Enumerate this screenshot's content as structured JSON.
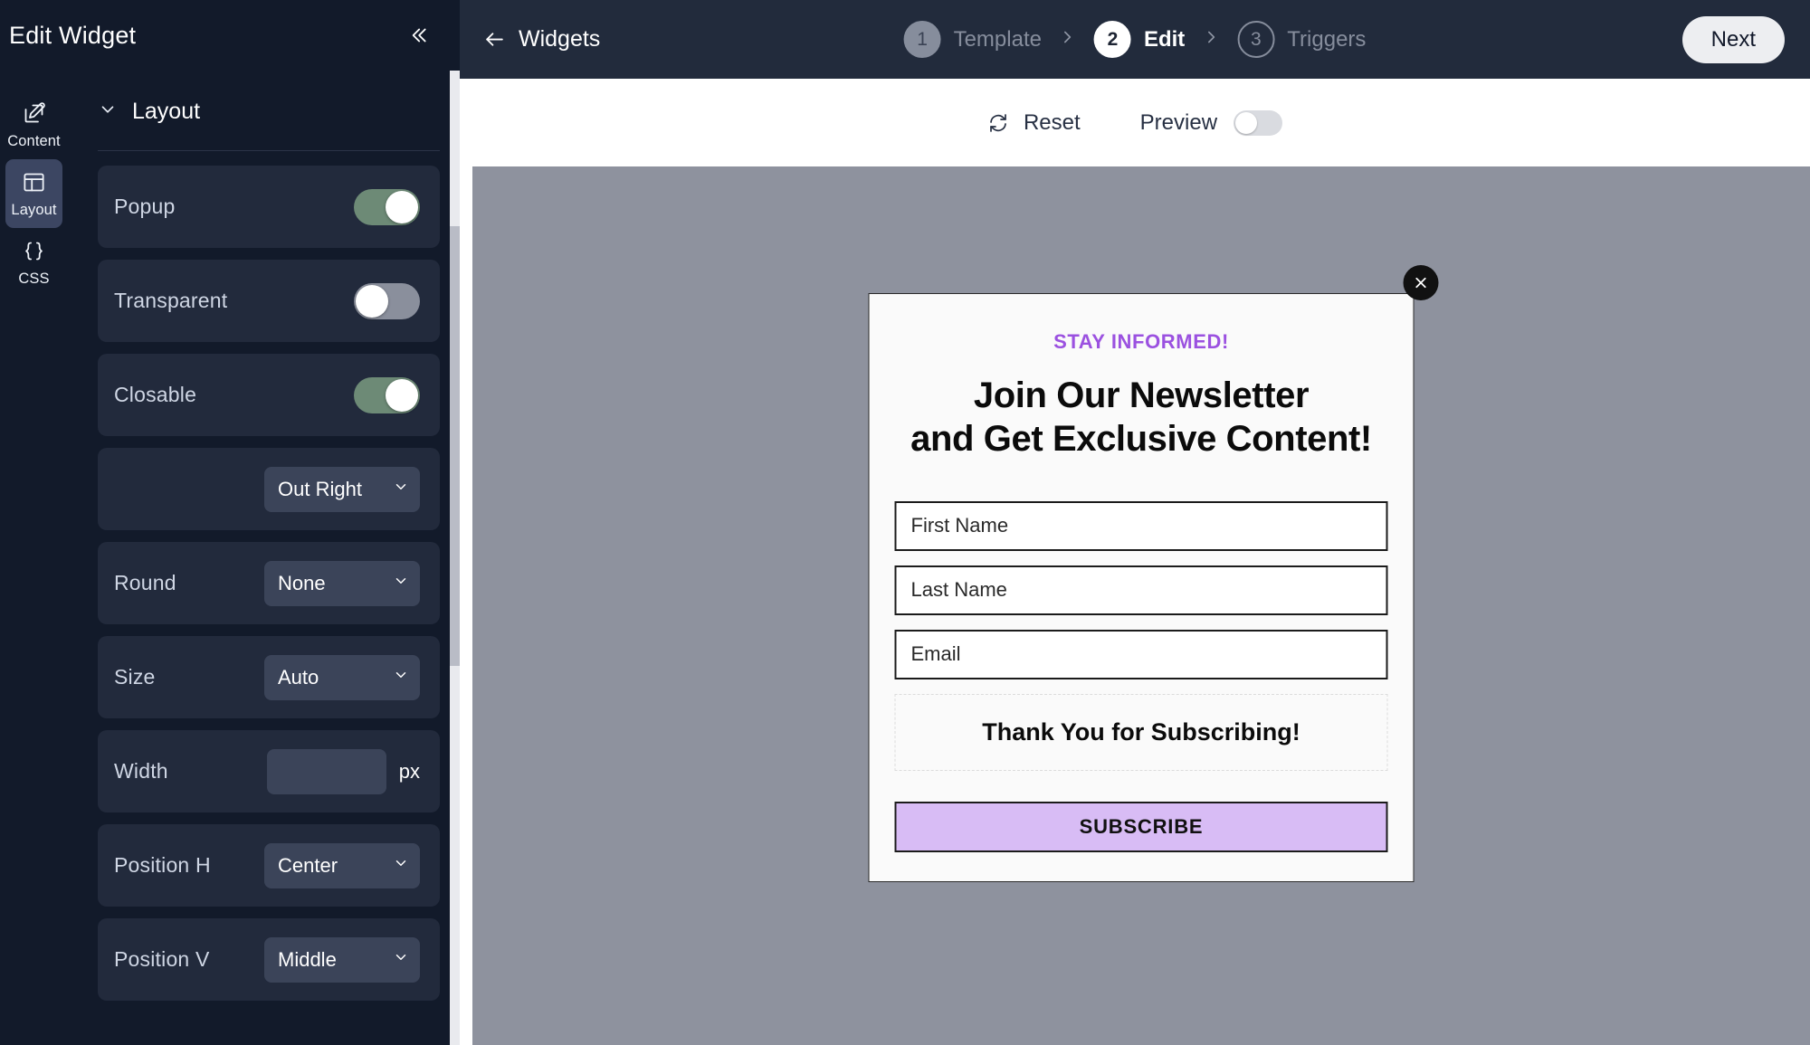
{
  "panel": {
    "title": "Edit Widget",
    "collapse_icon": "chevron-double-left-icon",
    "rail": [
      {
        "label": "Content",
        "icon": "pencil-square-icon",
        "active": false
      },
      {
        "label": "Layout",
        "icon": "layout-grid-icon",
        "active": true
      },
      {
        "label": "CSS",
        "icon": "curly-braces-icon",
        "active": false
      }
    ],
    "section": {
      "title": "Layout",
      "chevron_icon": "chevron-down-icon"
    },
    "rows": [
      {
        "label": "Popup",
        "type": "toggle",
        "value": "on"
      },
      {
        "label": "Transparent",
        "type": "toggle",
        "value": "off"
      },
      {
        "label": "Closable",
        "type": "toggle",
        "value": "on"
      },
      {
        "label": "",
        "type": "select",
        "value": "Out Right"
      },
      {
        "label": "Round",
        "type": "select",
        "value": "None"
      },
      {
        "label": "Size",
        "type": "select",
        "value": "Auto"
      },
      {
        "label": "Width",
        "type": "number",
        "value": "",
        "placeholder": "",
        "unit": "px"
      },
      {
        "label": "Position H",
        "type": "select",
        "value": "Center"
      },
      {
        "label": "Position V",
        "type": "select",
        "value": "Middle"
      }
    ]
  },
  "topbar": {
    "back_label": "Widgets",
    "back_icon": "arrow-left-icon",
    "separator_icon": "chevron-right-icon",
    "steps": [
      {
        "num": "1",
        "label": "Template",
        "state": "done"
      },
      {
        "num": "2",
        "label": "Edit",
        "state": "active"
      },
      {
        "num": "3",
        "label": "Triggers",
        "state": "todo"
      }
    ],
    "next_label": "Next"
  },
  "subbar": {
    "reset_label": "Reset",
    "reset_icon": "refresh-icon",
    "preview_label": "Preview",
    "preview_toggle": "off"
  },
  "modal": {
    "close_icon": "close-x-icon",
    "eyebrow": "STAY INFORMED!",
    "headline_line1": "Join Our Newsletter",
    "headline_line2": "and Get Exclusive Content!",
    "fields": [
      {
        "name": "first-name",
        "placeholder": "First Name",
        "value": ""
      },
      {
        "name": "last-name",
        "placeholder": "Last Name",
        "value": ""
      },
      {
        "name": "email",
        "placeholder": "Email",
        "value": ""
      }
    ],
    "thanks": "Thank You for Subscribing!",
    "submit_label": "SUBSCRIBE"
  },
  "colors": {
    "panel_bg": "#121a2a",
    "row_bg": "#222a3c",
    "control_bg": "#3b4459",
    "toggle_on": "#6d8a76",
    "toggle_off": "#8a8f9c",
    "topbar_bg": "#222b3c",
    "overlay": "#8e929e",
    "accent_purple": "#9b51e0",
    "button_lavender": "#d8bcf5"
  }
}
